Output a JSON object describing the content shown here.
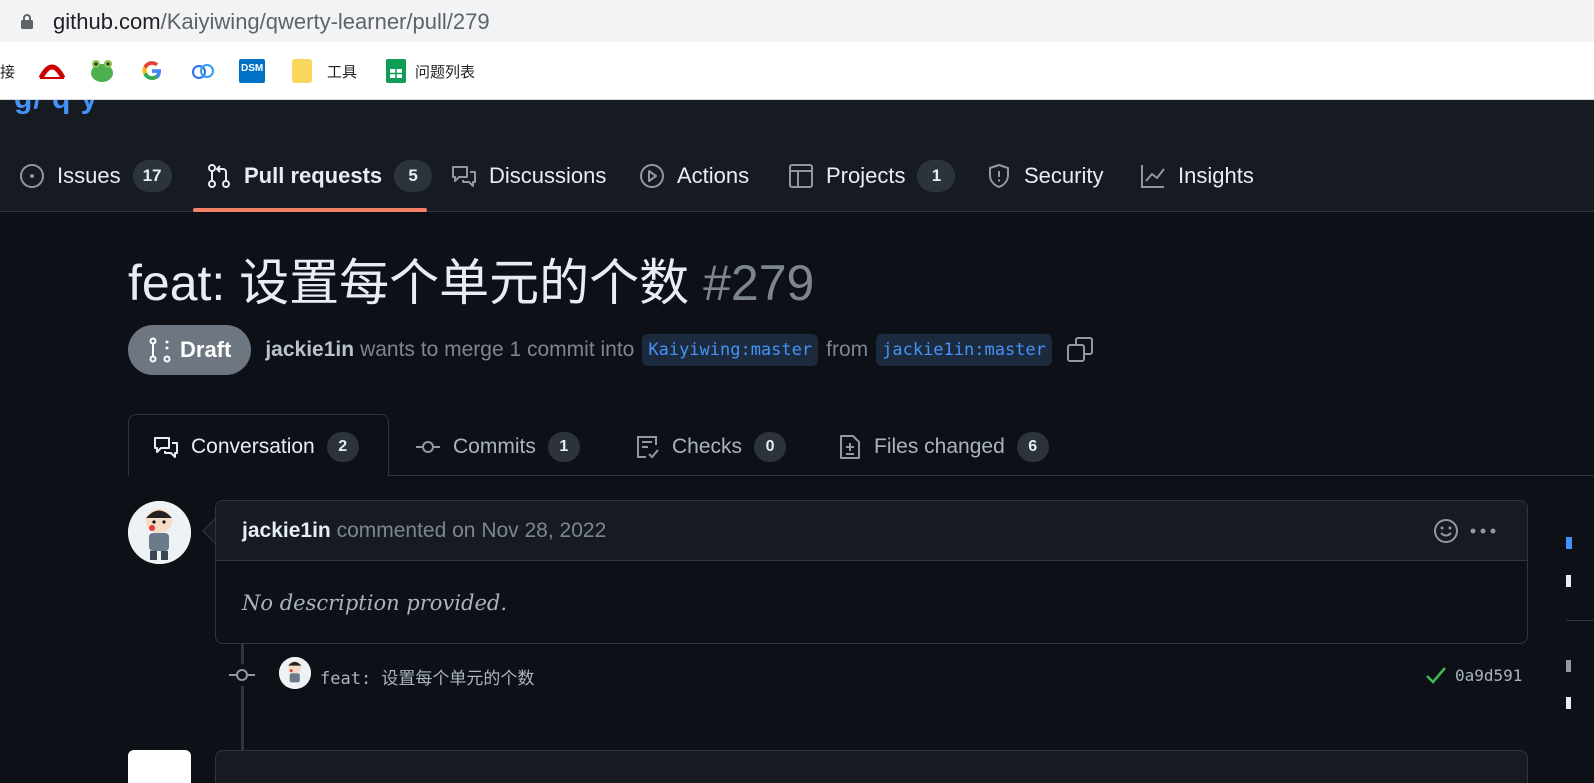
{
  "browser": {
    "url_host": "github.com",
    "url_path": "/Kaiyiwing/qwerty-learner/pull/279",
    "bookmarks": [
      {
        "label": "接",
        "icon": "link-cut-icon"
      },
      {
        "label": "",
        "icon": "redhat-icon"
      },
      {
        "label": "",
        "icon": "frog-icon"
      },
      {
        "label": "",
        "icon": "google-icon"
      },
      {
        "label": "",
        "icon": "cloud-icon"
      },
      {
        "label": "",
        "icon": "dsm-icon"
      },
      {
        "label": "工具",
        "icon": "folder-icon"
      },
      {
        "label": "问题列表",
        "icon": "sheets-icon"
      }
    ],
    "dsm_text": "DSM"
  },
  "repo_nav": {
    "tabs": [
      {
        "label": "Issues",
        "count": "17"
      },
      {
        "label": "Pull requests",
        "count": "5"
      },
      {
        "label": "Discussions",
        "count": ""
      },
      {
        "label": "Actions",
        "count": ""
      },
      {
        "label": "Projects",
        "count": "1"
      },
      {
        "label": "Security",
        "count": ""
      },
      {
        "label": "Insights",
        "count": ""
      }
    ]
  },
  "pr": {
    "title": "feat: 设置每个单元的个数",
    "number": "#279",
    "state": "Draft",
    "author": "jackie1in",
    "merge_text": "wants to merge 1 commit into",
    "base_branch": "Kaiyiwing:master",
    "from_text": "from",
    "head_branch": "jackie1in:master"
  },
  "pr_tabs": [
    {
      "label": "Conversation",
      "count": "2"
    },
    {
      "label": "Commits",
      "count": "1"
    },
    {
      "label": "Checks",
      "count": "0"
    },
    {
      "label": "Files changed",
      "count": "6"
    }
  ],
  "comment": {
    "author": "jackie1in",
    "action": "commented on Nov 28, 2022",
    "body": "No description provided."
  },
  "commit": {
    "message": "feat: 设置每个单元的个数",
    "sha": "0a9d591"
  },
  "colors": {
    "accent": "#f78166",
    "link": "#4493f8",
    "success": "#3fb950",
    "draft": "#6e7681"
  }
}
